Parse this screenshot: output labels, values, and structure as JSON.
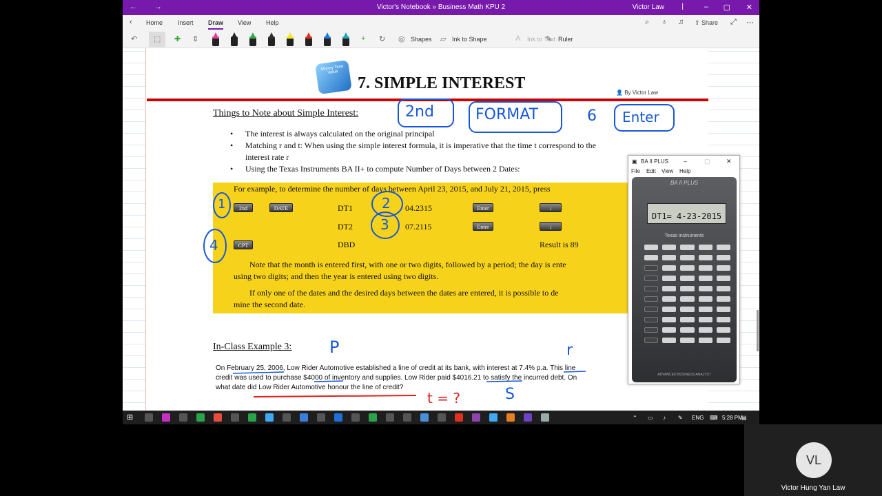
{
  "window": {
    "title": "Victor's Notebook » Business Math KPU 2",
    "user": "Victor Law",
    "sep": "|",
    "back_icon": "←",
    "forward_icon": "→",
    "min": "–",
    "max": "▢",
    "close": "✕"
  },
  "ribbon": {
    "tabs": [
      "Home",
      "Insert",
      "Draw",
      "View",
      "Help"
    ],
    "active_tab": "Draw",
    "share_label": "Share"
  },
  "toolbar": {
    "shapes": "Shapes",
    "ink_to_shape": "Ink to Shape",
    "ink_to_text": "Ink to Text",
    "ruler": "Ruler",
    "pen_colors": [
      "#e23b9a",
      "#222222",
      "#34a84a",
      "#2e2e2e",
      "#f5e61c",
      "#e0301e",
      "#1e7ad9",
      "#1fa3b8"
    ]
  },
  "note": {
    "dice_text": "Money Time Value",
    "title": "7. SIMPLE INTEREST",
    "byline": "By Victor Law",
    "things_heading": "Things to Note about Simple Interest:",
    "bullets": [
      "The interest is always calculated on the original principal",
      "Matching r and t: When using the simple interest formula, it is imperative that the time t correspond to the",
      "interest rate r",
      "Using the Texas Instruments BA II+ to compute Number of Days between 2 Dates:"
    ],
    "example": {
      "intro": "For example, to determine the number of days between April 23, 2015, and July 21, 2015, press",
      "key_2nd": "2nd",
      "key_date": "DATE",
      "dt1": "DT1",
      "dt1_val": "04.2315",
      "dt2": "DT2",
      "dt2_val": "07.2115",
      "enter": "Enter",
      "down": "↓",
      "key_cpt": "CPT",
      "dbd": "DBD",
      "result": "Result is 89",
      "note1a": "Note that the month is entered first, with one or two digits, followed by a period; the day is ente",
      "note1b": "using two digits; and then the year is entered using two digits.",
      "note2a": "If only one of the dates and the desired days between the dates are entered, it is possible to de",
      "note2b": "mine the second date."
    },
    "inclass_heading": "In-Class Example 3:",
    "problem": [
      "On February 25, 2006, Low Rider Automotive established a line of credit at its bank, with interest at 7.4% p.a. This line",
      "credit was used to purchase $4000 of inventory and supplies. Low Rider paid $4016.21 to satisfy the incurred debt. On",
      "what date did Low Rider Automotive honour the line of credit?"
    ]
  },
  "ink": {
    "k1": "2nd",
    "k2": "FORMAT",
    "k3": "6",
    "k4": "Enter",
    "c1": "1",
    "c2": "2",
    "c3": "3",
    "c4": "4",
    "p": "P",
    "r": "r",
    "s": "S",
    "t": "t = ?"
  },
  "calculator": {
    "title": "BA II PLUS",
    "menu": [
      "File",
      "Edit",
      "View",
      "Help"
    ],
    "brand": "BA II PLUS",
    "display": "DT1= 4-23-2015",
    "maker": "Texas Instruments",
    "footer": "ADVANCED BUSINESS ANALYST"
  },
  "taskbar": {
    "lang": "ENG",
    "time": "5:28 PM"
  },
  "participant": {
    "initials": "VL",
    "name": "Victor Hung Yan Law"
  }
}
